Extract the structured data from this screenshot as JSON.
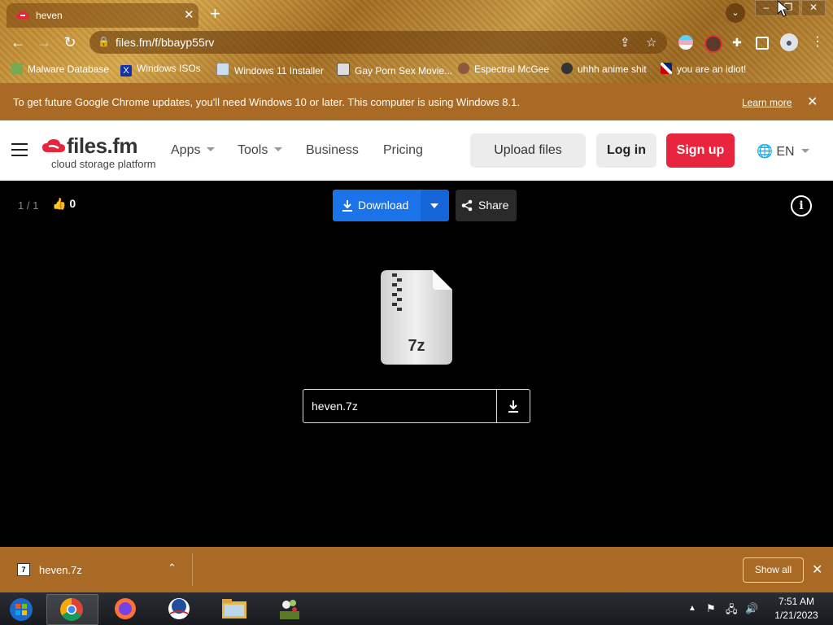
{
  "browser": {
    "tab_title": "heven",
    "url": "files.fm/f/bbayp55rv",
    "bookmarks": [
      {
        "label": "Malware Database",
        "icon": "bug-icon"
      },
      {
        "label": "Windows ISOs",
        "icon": "x-logo-icon"
      },
      {
        "label": "Windows 11 Installer",
        "icon": "image-icon"
      },
      {
        "label": "Gay Porn Sex Movie...",
        "icon": "site-icon"
      },
      {
        "label": "Espectral McGee",
        "icon": "avatar-icon"
      },
      {
        "label": "uhhh anime shit",
        "icon": "anime-icon"
      },
      {
        "label": "you are an idiot!",
        "icon": "flag-icon"
      }
    ],
    "infobar": {
      "message": "To get future Google Chrome updates, you'll need Windows 10 or later. This computer is using Windows 8.1.",
      "link": "Learn more"
    }
  },
  "site": {
    "logo_name": "files.fm",
    "logo_tagline": "cloud storage platform",
    "nav": {
      "apps": "Apps",
      "tools": "Tools",
      "business": "Business",
      "pricing": "Pricing"
    },
    "upload_label": "Upload files",
    "login_label": "Log in",
    "signup_label": "Sign up",
    "lang_label": "EN",
    "brand_color": "#e8253d"
  },
  "viewer": {
    "counter": "1 / 1",
    "likes": "0",
    "download_label": "Download",
    "share_label": "Share",
    "file_ext": "7z",
    "file_name": "heven.7z",
    "accent_color": "#1a73e8"
  },
  "download_shelf": {
    "item_name": "heven.7z",
    "show_all_label": "Show all"
  },
  "taskbar": {
    "time": "7:51 AM",
    "date": "1/21/2023"
  }
}
